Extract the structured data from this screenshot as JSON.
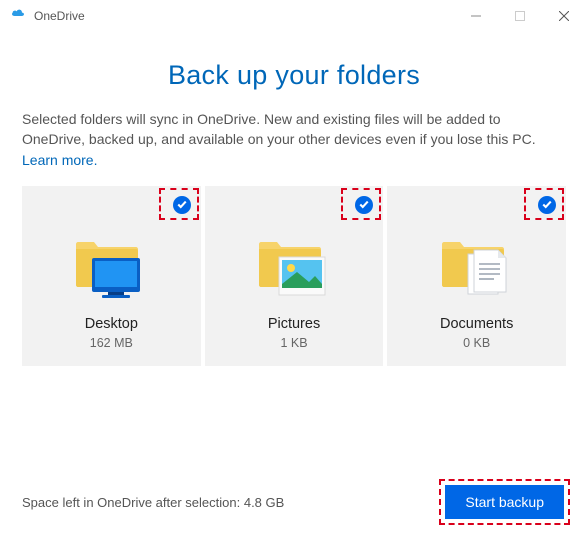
{
  "titlebar": {
    "app_name": "OneDrive"
  },
  "heading": "Back up your folders",
  "description_prefix": "Selected folders will sync in OneDrive. New and existing files will be added to OneDrive, backed up, and available on your other devices even if you lose this PC. ",
  "learn_more": "Learn more.",
  "folders": [
    {
      "name": "Desktop",
      "size": "162 MB"
    },
    {
      "name": "Pictures",
      "size": "1 KB"
    },
    {
      "name": "Documents",
      "size": "0 KB"
    }
  ],
  "space_left_label": "Space left in OneDrive after selection: ",
  "space_left_value": "4.8 GB",
  "start_button": "Start backup"
}
